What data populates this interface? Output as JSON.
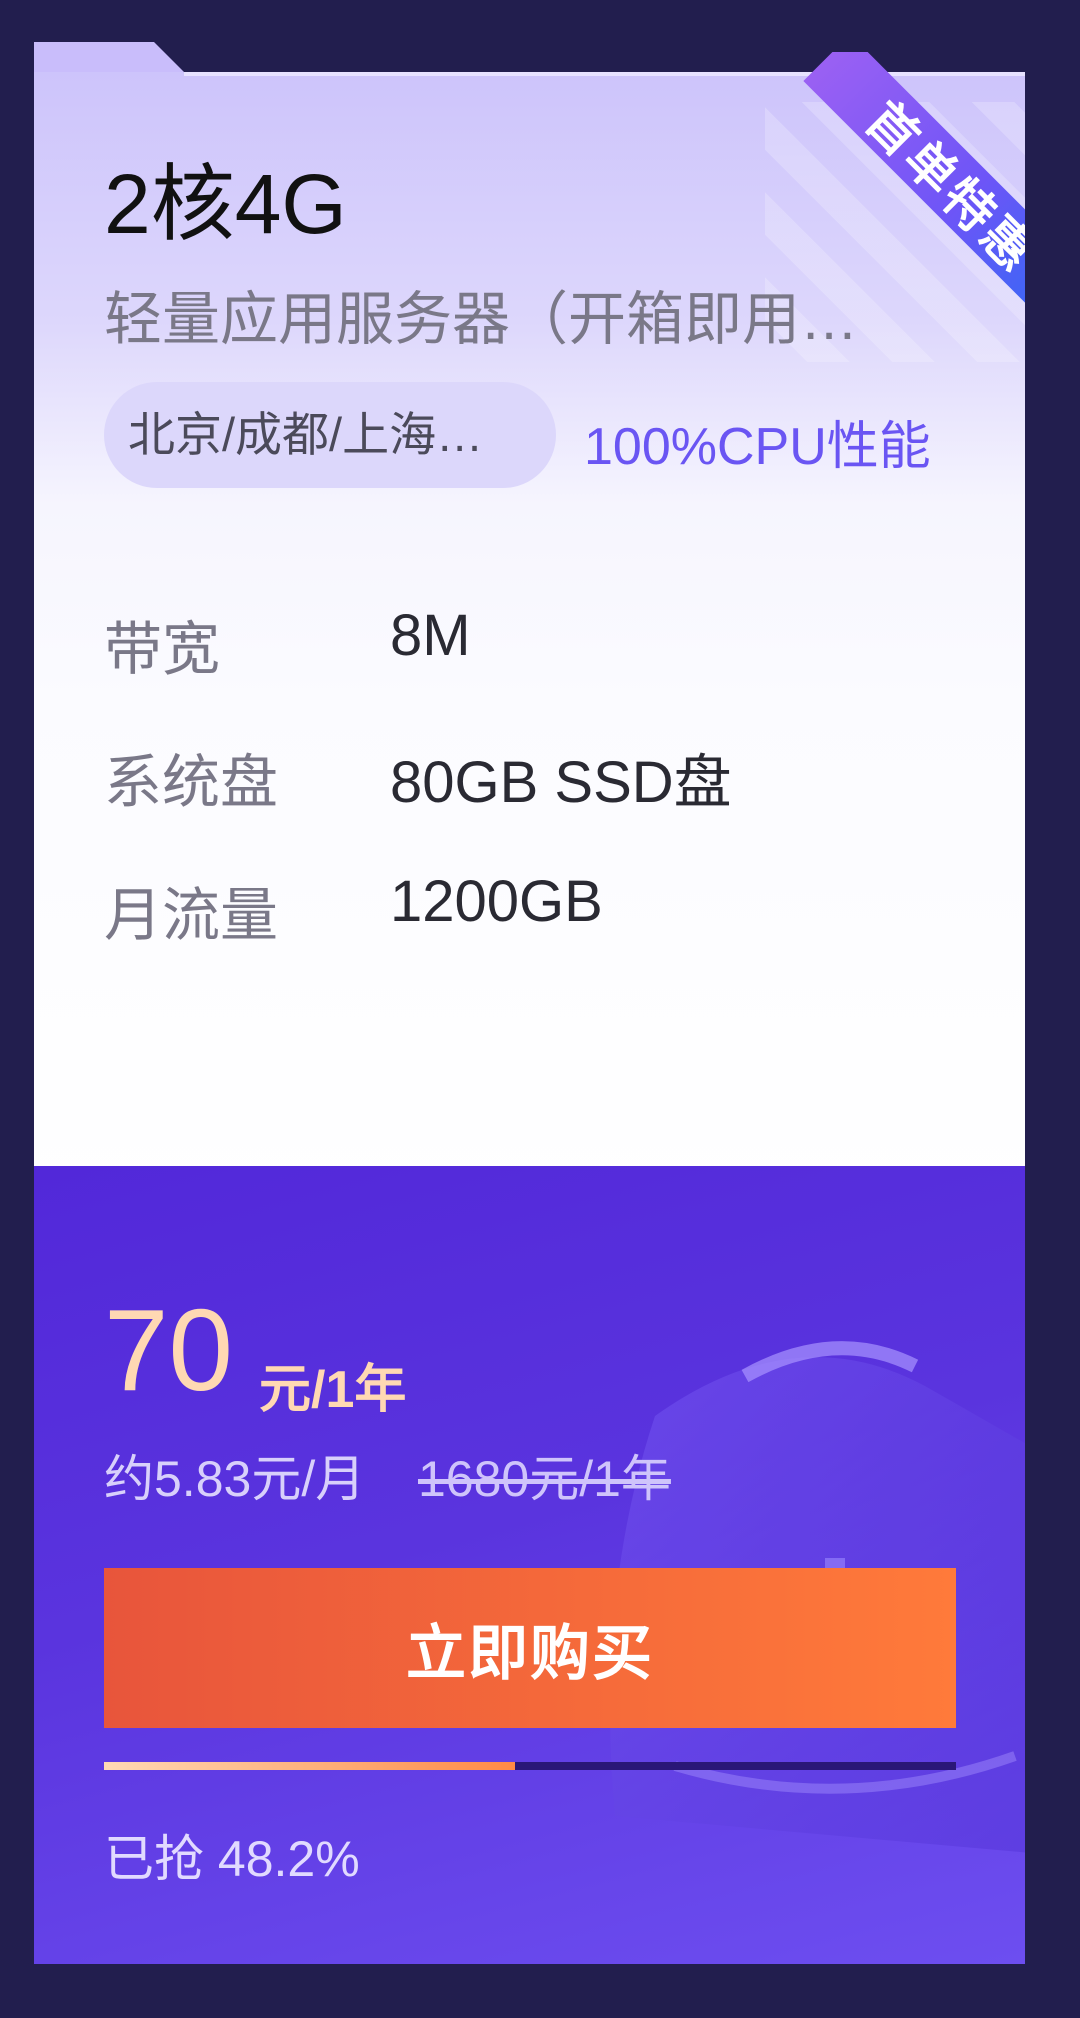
{
  "plan": {
    "title": "2核4G",
    "subtitle": "轻量应用服务器（开箱即用…",
    "badge": "首单特惠",
    "region": "北京/成都/上海…",
    "cpu_note": "100%CPU性能",
    "specs": [
      {
        "label": "带宽",
        "value": "8M"
      },
      {
        "label": "系统盘",
        "value": "80GB SSD盘"
      },
      {
        "label": "月流量",
        "value": "1200GB"
      }
    ]
  },
  "pricing": {
    "price": "70",
    "unit": "元/1年",
    "monthly": "约5.83元/月",
    "original": "1680元/1年",
    "buy_label": "立即购买",
    "sold_text": "已抢 48.2%",
    "sold_percent": 48.2
  },
  "colors": {
    "accent": "#6a55f3",
    "price": "#ffd8b3",
    "button_start": "#e8553b",
    "button_end": "#ff7a3a",
    "background": "#221e4e"
  },
  "icons": {
    "decoration": "server-box-gear-icon"
  }
}
